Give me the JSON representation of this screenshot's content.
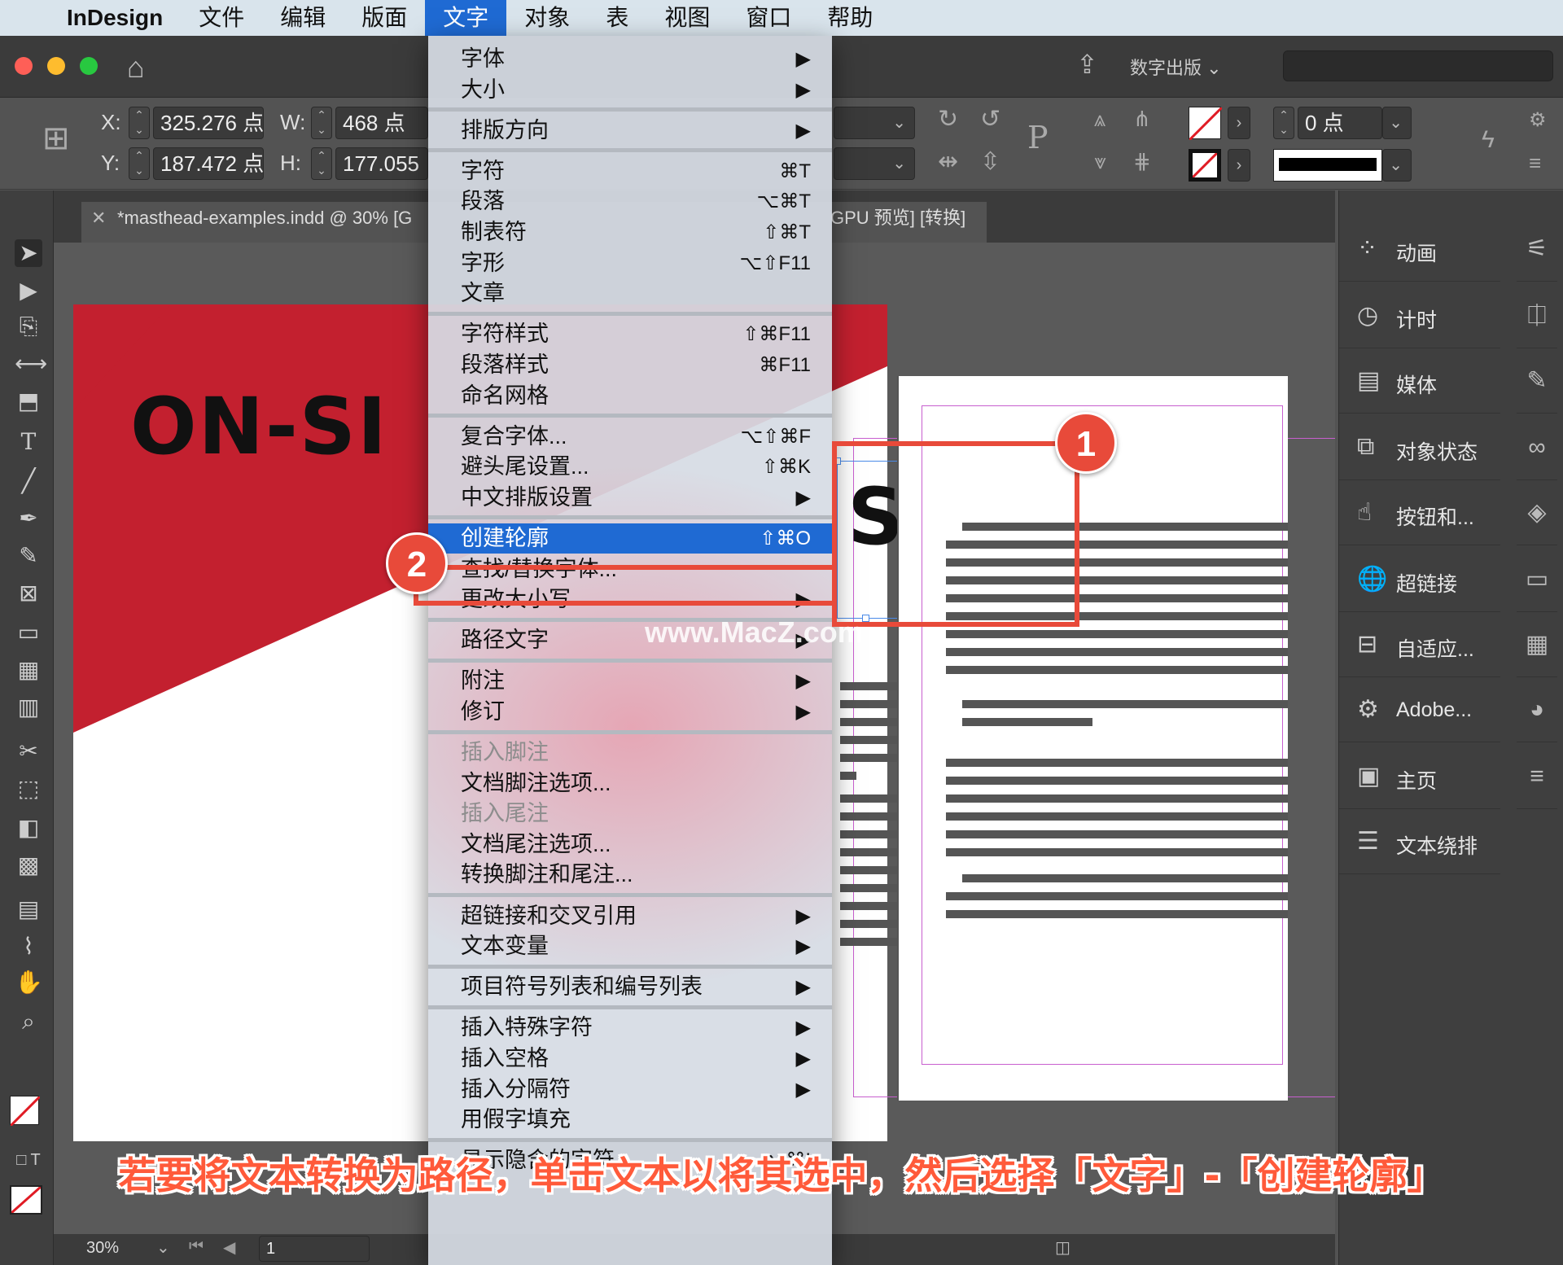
{
  "menubar": {
    "items": [
      "InDesign",
      "文件",
      "编辑",
      "版面",
      "文字",
      "对象",
      "表",
      "视图",
      "窗口",
      "帮助"
    ],
    "active": "文字"
  },
  "appbar": {
    "workspace": "数字出版"
  },
  "control": {
    "x_label": "X:",
    "x_value": "325.276 点",
    "y_label": "Y:",
    "y_value": "187.472 点",
    "w_label": "W:",
    "w_value": "468 点",
    "h_label": "H:",
    "h_value": "177.055",
    "stroke_weight": "0 点"
  },
  "document": {
    "tab_title": "*masthead-examples.indd @ 30% [G",
    "tab_title_suffix": "GPU 预览] [转换]",
    "heading_left": "ON-SI",
    "heading_right": "SITE"
  },
  "menu": {
    "groups": [
      [
        {
          "label": "字体",
          "shortcut": "▶"
        },
        {
          "label": "大小",
          "shortcut": "▶"
        }
      ],
      [
        {
          "label": "排版方向",
          "shortcut": "▶"
        }
      ],
      [
        {
          "label": "字符",
          "shortcut": "⌘T"
        },
        {
          "label": "段落",
          "shortcut": "⌥⌘T"
        },
        {
          "label": "制表符",
          "shortcut": "⇧⌘T"
        },
        {
          "label": "字形",
          "shortcut": "⌥⇧F11"
        },
        {
          "label": "文章",
          "shortcut": ""
        }
      ],
      [
        {
          "label": "字符样式",
          "shortcut": "⇧⌘F11"
        },
        {
          "label": "段落样式",
          "shortcut": "⌘F11"
        },
        {
          "label": "命名网格",
          "shortcut": ""
        }
      ],
      [
        {
          "label": "复合字体...",
          "shortcut": "⌥⇧⌘F"
        },
        {
          "label": "避头尾设置...",
          "shortcut": "⇧⌘K"
        },
        {
          "label": "中文排版设置",
          "shortcut": "▶"
        }
      ],
      [
        {
          "label": "创建轮廓",
          "shortcut": "⇧⌘O",
          "selected": true
        },
        {
          "label": "查找/替换字体...",
          "shortcut": ""
        },
        {
          "label": "更改大小写",
          "shortcut": "▶"
        }
      ],
      [
        {
          "label": "路径文字",
          "shortcut": "▶"
        }
      ],
      [
        {
          "label": "附注",
          "shortcut": "▶"
        },
        {
          "label": "修订",
          "shortcut": "▶"
        }
      ],
      [
        {
          "label": "插入脚注",
          "shortcut": "",
          "disabled": true
        },
        {
          "label": "文档脚注选项...",
          "shortcut": ""
        },
        {
          "label": "插入尾注",
          "shortcut": "",
          "disabled": true
        },
        {
          "label": "文档尾注选项...",
          "shortcut": ""
        },
        {
          "label": "转换脚注和尾注...",
          "shortcut": ""
        }
      ],
      [
        {
          "label": "超链接和交叉引用",
          "shortcut": "▶"
        },
        {
          "label": "文本变量",
          "shortcut": "▶"
        }
      ],
      [
        {
          "label": "项目符号列表和编号列表",
          "shortcut": "▶"
        }
      ],
      [
        {
          "label": "插入特殊字符",
          "shortcut": "▶"
        },
        {
          "label": "插入空格",
          "shortcut": "▶"
        },
        {
          "label": "插入分隔符",
          "shortcut": "▶"
        },
        {
          "label": "用假字填充",
          "shortcut": ""
        }
      ],
      [
        {
          "label": "显示隐含的字符",
          "shortcut": "⌥⌘I"
        }
      ]
    ]
  },
  "panels": {
    "items": [
      {
        "label": "动画",
        "icon": "animation-icon"
      },
      {
        "label": "计时",
        "icon": "timer-icon"
      },
      {
        "label": "媒体",
        "icon": "media-icon"
      },
      {
        "label": "对象状态",
        "icon": "object-states-icon"
      },
      {
        "label": "按钮和...",
        "icon": "buttons-icon"
      },
      {
        "label": "超链接",
        "icon": "hyperlinks-icon"
      },
      {
        "label": "自适应...",
        "icon": "liquid-layout-icon"
      },
      {
        "label": "Adobe...",
        "icon": "adobe-icon"
      },
      {
        "label": "主页",
        "icon": "pages-icon"
      },
      {
        "label": "文本绕排",
        "icon": "text-wrap-icon"
      }
    ]
  },
  "status": {
    "zoom": "30%",
    "page": "1"
  },
  "annotations": {
    "badge1": "1",
    "badge2": "2",
    "caption": "若要将文本转换为路径，单击文本以将其选中，然后选择「文字」-「创建轮廓」",
    "watermark": "www.MacZ.com"
  },
  "colors": {
    "accent": "#1f6ad3",
    "annotation": "#e84a3a",
    "brand_red": "#c3202f"
  }
}
